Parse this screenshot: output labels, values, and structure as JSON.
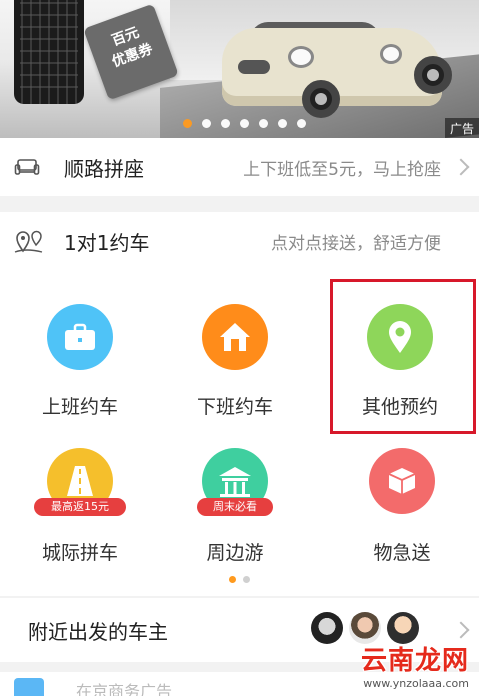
{
  "banner": {
    "coupon_line1": "百元",
    "coupon_line2": "优惠券",
    "ad_label": "广告",
    "dots": 7,
    "active_dot": 0
  },
  "carpool": {
    "icon": "sofa-icon",
    "title": "顺路拼座",
    "subtitle": "上下班低至5元，马上抢座"
  },
  "booking": {
    "icon": "location-pins-icon",
    "title": "1对1约车",
    "subtitle": "点对点接送，舒适方便"
  },
  "services": [
    {
      "label": "上班约车",
      "icon": "briefcase-icon",
      "color": "#4fc3f7"
    },
    {
      "label": "下班约车",
      "icon": "house-icon",
      "color": "#ff8c1a"
    },
    {
      "label": "其他预约",
      "icon": "map-pin-icon",
      "color": "#8ed65a"
    },
    {
      "label": "城际拼车",
      "icon": "road-icon",
      "color": "#f5bf2c",
      "badge": "最高返15元",
      "badge_color": "#e63f3f"
    },
    {
      "label": "周边游",
      "icon": "pavilion-icon",
      "color": "#3fcf9f",
      "badge": "周末必看",
      "badge_color": "#e63f3f"
    },
    {
      "label": "物急送",
      "icon": "box-icon",
      "color": "#f36b6b"
    }
  ],
  "pager": {
    "pages": 2,
    "active": 0
  },
  "nearby": {
    "title": "附近出发的车主"
  },
  "bottom": {
    "text": "在京商务广告"
  },
  "watermark": {
    "main": "云南龙网",
    "url": "www.ynzolaaa.com"
  },
  "colors": {
    "accent": "#ff9a1e",
    "highlight": "#d7182a"
  }
}
